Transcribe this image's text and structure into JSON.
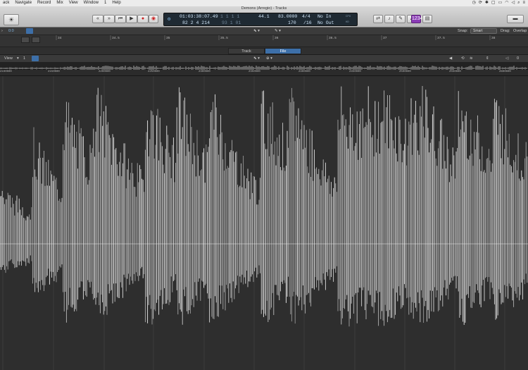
{
  "menubar": {
    "items": [
      "ack",
      "Navigate",
      "Record",
      "Mix",
      "View",
      "Window",
      "1",
      "Help"
    ]
  },
  "window": {
    "title": "Demons (Arregio) - Tracks"
  },
  "transport": {
    "rewind_icon": "rewind-icon",
    "forward_icon": "fast-forward-icon",
    "to_start_icon": "go-to-start-icon",
    "play_icon": "play-icon",
    "record_icon": "record-icon",
    "cycle_icon": "cycle-icon"
  },
  "lcd": {
    "timecode": "01:03:38:07.49",
    "bars_beats": "82 2 4 214",
    "bar_row1": "1   1   1   1",
    "bar_row2": "93   1   01",
    "tempo_key": "44.1",
    "tempo": "83.0000",
    "tempo_lower": "170",
    "signature": "4/4",
    "division": "/16",
    "input": "No In",
    "output": "No Out",
    "cpu_label": "CPU",
    "hd_label": "HD"
  },
  "toolbar": {
    "position_label": "0:0",
    "snap_label": "Snap:",
    "snap_value": "Smart",
    "drag_label": "Drag:",
    "drag_value": "Overlap"
  },
  "bar_ruler": [
    "34",
    "34.5",
    "35",
    "35.5",
    "36",
    "36.5",
    "37",
    "37.5",
    "38"
  ],
  "tabs": [
    {
      "label": "Track",
      "active": false
    },
    {
      "label": "File",
      "active": true
    }
  ],
  "view_row": {
    "label": "View",
    "number": "1"
  },
  "sample_ruler": [
    "2100000",
    "2150000",
    "2200000",
    "2250000",
    "2300000",
    "2350000",
    "2400000",
    "2450000",
    "2500000",
    "2550000",
    "2600000"
  ],
  "colors": {
    "accent": "#3d6fa8",
    "background": "#2e2e2e",
    "waveform": "#d7d7d7",
    "lcd": "#1f2a33"
  }
}
